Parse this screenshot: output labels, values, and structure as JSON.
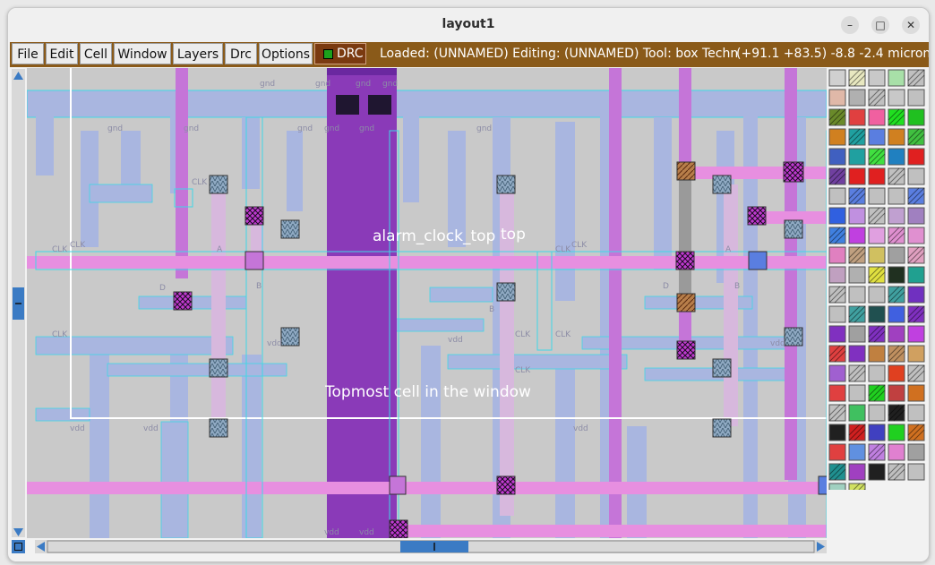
{
  "window": {
    "title": "layout1"
  },
  "menu": {
    "file": "File",
    "edit": "Edit",
    "cell": "Cell",
    "window": "Window",
    "layers": "Layers",
    "drc": "Drc",
    "options": "Options",
    "drc_indicator": "DRC"
  },
  "status": {
    "loaded": "Loaded: (UNNAMED) Editing: (UNNAMED) Tool: box  Techn",
    "coords": "(+91.1 +83.5) -8.8 -2.4 microns"
  },
  "canvas": {
    "cell_label": "alarm_clock_top",
    "cell_label_overlap": "top",
    "window_label": "Topmost cell in the window",
    "net_gnd": "gnd",
    "net_vdd": "vdd",
    "net_clk": "CLK",
    "small_a": "A",
    "small_b": "B",
    "small_d": "D"
  },
  "colors": {
    "menubar_bg": "#8a5a19",
    "canvas_bg": "#c9c9c9",
    "metal1": "#a9b6e0",
    "metal2": "#e78fe0",
    "metal3": "#8a3ab8",
    "outline": "#3fd8e6"
  }
}
